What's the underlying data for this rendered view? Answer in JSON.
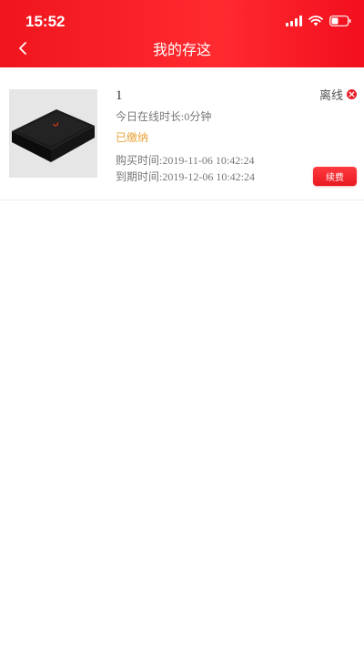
{
  "status_bar": {
    "time": "15:52",
    "icons": [
      "signal-icon",
      "wifi-icon",
      "battery-icon"
    ]
  },
  "nav": {
    "title": "我的存这",
    "back_icon": "chevron-left-icon"
  },
  "colors": {
    "header_red": "#f0151d",
    "paid_orange": "#e8a33a",
    "offline_red": "#e8202a"
  },
  "device": {
    "name": "1",
    "online_time": "今日在线时长:0分钟",
    "pay_status": "已缴纳",
    "buy_time": "购买时间:2019-11-06 10:42:24",
    "expire_time": "到期时间:2019-12-06 10:42:24",
    "status": "离线",
    "status_icon": "close-circle-icon",
    "renew_label": "续费"
  }
}
